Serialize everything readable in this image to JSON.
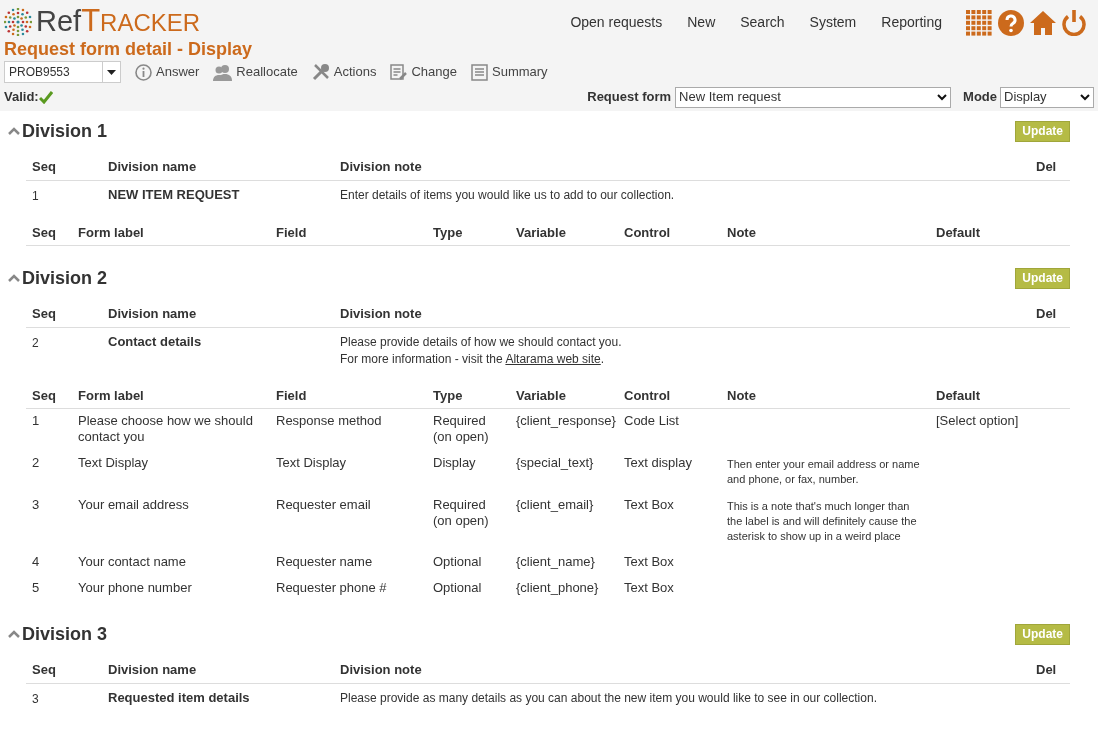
{
  "logo": {
    "prefix": "Ref",
    "initial": "T",
    "rest": "RACKER"
  },
  "nav": [
    "Open requests",
    "New",
    "Search",
    "System",
    "Reporting"
  ],
  "page_title": "Request form detail - Display",
  "request_select": {
    "value": "PROB9553"
  },
  "toolbar": [
    {
      "label": "Answer"
    },
    {
      "label": "Reallocate"
    },
    {
      "label": "Actions"
    },
    {
      "label": "Change"
    },
    {
      "label": "Summary"
    }
  ],
  "valid": {
    "label": "Valid:",
    "ok": true
  },
  "request_form": {
    "label": "Request form",
    "value": "New Item request"
  },
  "mode": {
    "label": "Mode",
    "value": "Display"
  },
  "divisions": [
    {
      "title": "Division 1",
      "expanded": true,
      "button": "Update",
      "division_columns": [
        "Seq",
        "Division name",
        "Division note",
        "Del"
      ],
      "division_row": {
        "seq": "1",
        "name": "NEW ITEM REQUEST",
        "note": [
          {
            "text": "Enter details of items you would like us to add to our collection."
          }
        ]
      },
      "field_columns": [
        "Seq",
        "Form label",
        "Field",
        "Type",
        "Variable",
        "Control",
        "Note",
        "Default"
      ]
    },
    {
      "title": "Division 2",
      "expanded": true,
      "button": "Update",
      "division_columns": [
        "Seq",
        "Division name",
        "Division note",
        "Del"
      ],
      "division_row": {
        "seq": "2",
        "name": "Contact details",
        "note": [
          {
            "text": "Please provide details of how we should contact you."
          },
          {
            "text": "For more information - visit the ",
            "link": "Altarama web site",
            "after": "."
          }
        ]
      },
      "field_columns": [
        "Seq",
        "Form label",
        "Field",
        "Type",
        "Variable",
        "Control",
        "Note",
        "Default"
      ],
      "fields": [
        {
          "seq": "1",
          "label": "Please choose how we should contact you",
          "field": "Response method",
          "type": "Required (on open)",
          "variable": "{client_response}",
          "control": "Code List",
          "default": "[Select option]"
        },
        {
          "seq": "2",
          "label": "Text Display",
          "field": "Text Display",
          "type": "Display",
          "variable": "{special_text}",
          "control": "Text display",
          "note": "Then enter your email address or name and phone, or fax, number."
        },
        {
          "seq": "3",
          "label": "Your email address",
          "field": "Requester email",
          "type": "Required (on open)",
          "variable": "{client_email}",
          "control": "Text Box",
          "note": "This is a note that's much longer than the label is and will definitely cause the asterisk to show up in a weird place"
        },
        {
          "seq": "4",
          "label": "Your contact name",
          "field": "Requester name",
          "type": "Optional",
          "variable": "{client_name}",
          "control": "Text Box"
        },
        {
          "seq": "5",
          "label": "Your phone number",
          "field": "Requester phone #",
          "type": "Optional",
          "variable": "{client_phone}",
          "control": "Text Box"
        }
      ]
    },
    {
      "title": "Division 3",
      "expanded": true,
      "button": "Update",
      "division_columns": [
        "Seq",
        "Division name",
        "Division note",
        "Del"
      ],
      "division_row": {
        "seq": "3",
        "name": "Requested item details",
        "note": [
          {
            "text": "Please provide as many details as you can about the new item you would like to see in our collection."
          }
        ]
      }
    }
  ]
}
